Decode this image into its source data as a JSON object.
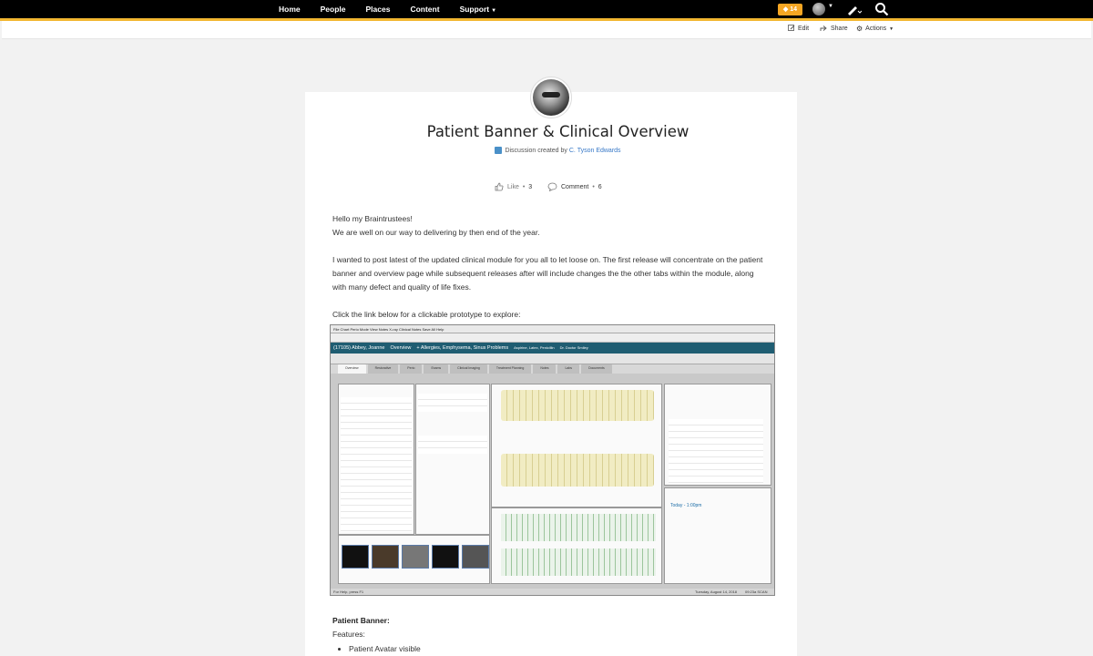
{
  "nav": {
    "items": [
      {
        "label": "Home"
      },
      {
        "label": "People"
      },
      {
        "label": "Places"
      },
      {
        "label": "Content"
      },
      {
        "label": "Support"
      }
    ],
    "notifications_count": "14",
    "accent_color": "#f2b731"
  },
  "subheader": {
    "edit_label": "Edit",
    "share_label": "Share",
    "actions_label": "Actions"
  },
  "post": {
    "title": "Patient Banner & Clinical Overview",
    "byline_prefix": "Discussion created by",
    "author": "C. Tyson Edwards",
    "like_label": "Like",
    "like_count": "3",
    "comment_label": "Comment",
    "comment_count": "6",
    "paragraphs": [
      "Hello my Braintrustees!",
      "We are well on our way to delivering  by then end of the year.",
      "I wanted to post latest of the updated clinical module for you all to let loose on. The first release will concentrate on the patient banner and overview page while subsequent releases after will include changes the the other tabs within the module, along with many defect and quality of life fixes.",
      "Click the link below for a clickable prototype to explore:"
    ],
    "section_title": "Patient Banner:",
    "features_label": "Features:",
    "features": [
      "Patient Avatar visible"
    ]
  },
  "embedded_screenshot": {
    "menu": "File  Chart  Perio  Mode  View  Notes  X-ray  Clinical Notes  Save All  Help",
    "banner_patient": "(17105) Abbey, Joanne",
    "banner_view": "Overview",
    "banner_alerts": "+ Allergies, Emphysema, Sinus Problems",
    "banner_allergies": "Aspirine, Latex, Penicillin",
    "banner_provider": "Dr. Doctor Smiley",
    "tabs": [
      "Overview",
      "Restorative",
      "Perio",
      "Exams",
      "Clinical Imaging",
      "Treatment Planning",
      "Notes",
      "Labs",
      "Documents"
    ],
    "status_left": "For Help, press F1",
    "status_date": "Tuesday, August 14, 2018",
    "status_right": "09:23a  SCAN",
    "next_appt": "Today - 1:00pm",
    "bg_color": "#c9c9c9",
    "banner_color": "#1f5d72"
  }
}
